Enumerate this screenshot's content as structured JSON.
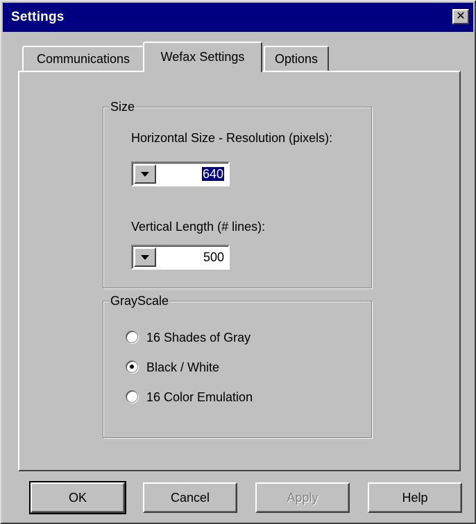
{
  "window": {
    "title": "Settings",
    "close_glyph": "✕"
  },
  "tabs": [
    {
      "label": "Communications",
      "active": false
    },
    {
      "label": "Wefax Settings",
      "active": true
    },
    {
      "label": "Options",
      "active": false
    }
  ],
  "size_group": {
    "label": "Size",
    "horizontal": {
      "label": "Horizontal Size - Resolution (pixels):",
      "value": "640"
    },
    "vertical": {
      "label": "Vertical Length (# lines):",
      "value": "500"
    }
  },
  "grayscale_group": {
    "label": "GrayScale",
    "options": [
      {
        "label": "16 Shades of Gray",
        "selected": false
      },
      {
        "label": "Black / White",
        "selected": true
      },
      {
        "label": "16 Color Emulation",
        "selected": false
      }
    ]
  },
  "buttons": {
    "ok": "OK",
    "cancel": "Cancel",
    "apply": "Apply",
    "help": "Help"
  },
  "colors": {
    "titlebar": "#000080",
    "face": "#c0c0c0",
    "selection": "#000080"
  }
}
